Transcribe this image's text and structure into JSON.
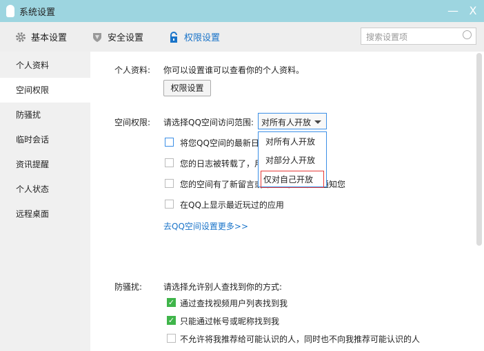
{
  "window": {
    "title": "系统设置",
    "minimize": "—",
    "close": "X"
  },
  "toolbar": {
    "tabs": [
      {
        "label": "基本设置"
      },
      {
        "label": "安全设置"
      },
      {
        "label": "权限设置"
      }
    ],
    "search_placeholder": "搜索设置项"
  },
  "sidebar": {
    "items": [
      {
        "label": "个人资料"
      },
      {
        "label": "空间权限"
      },
      {
        "label": "防骚扰"
      },
      {
        "label": "临时会话"
      },
      {
        "label": "资讯提醒"
      },
      {
        "label": "个人状态"
      },
      {
        "label": "远程桌面"
      }
    ]
  },
  "profile": {
    "label": "个人资料:",
    "desc": "你可以设置谁可以查看你的个人资料。",
    "button": "权限设置"
  },
  "space": {
    "label": "空间权限:",
    "prompt": "请选择QQ空间访问范围:",
    "selected": "对所有人开放",
    "options": [
      "对所有人开放",
      "对部分人开放",
      "仅对自己开放"
    ],
    "checks": [
      {
        "label": "将您QQ空间的最新日志显示在QQ上",
        "checked": false
      },
      {
        "label": "您的日志被转载了，用消息通知您",
        "checked": false
      },
      {
        "label": "您的空间有了新留言或评论时，用消息通知您",
        "checked": false
      },
      {
        "label": "在QQ上显示最近玩过的应用",
        "checked": false
      }
    ],
    "link": "去QQ空间设置更多>>"
  },
  "harass": {
    "label": "防骚扰:",
    "prompt": "请选择允许别人查找到你的方式:",
    "checks": [
      {
        "label": "通过查找视频用户列表找到我",
        "checked": true
      },
      {
        "label": "只能通过帐号或昵称找到我",
        "checked": true
      },
      {
        "label": "不允许将我推荐给可能认识的人，同时也不向我推荐可能认识的人",
        "checked": false
      }
    ]
  },
  "colors": {
    "accent": "#1a74c9",
    "titlebar": "#9dd5e0",
    "check": "#3fb54a"
  }
}
